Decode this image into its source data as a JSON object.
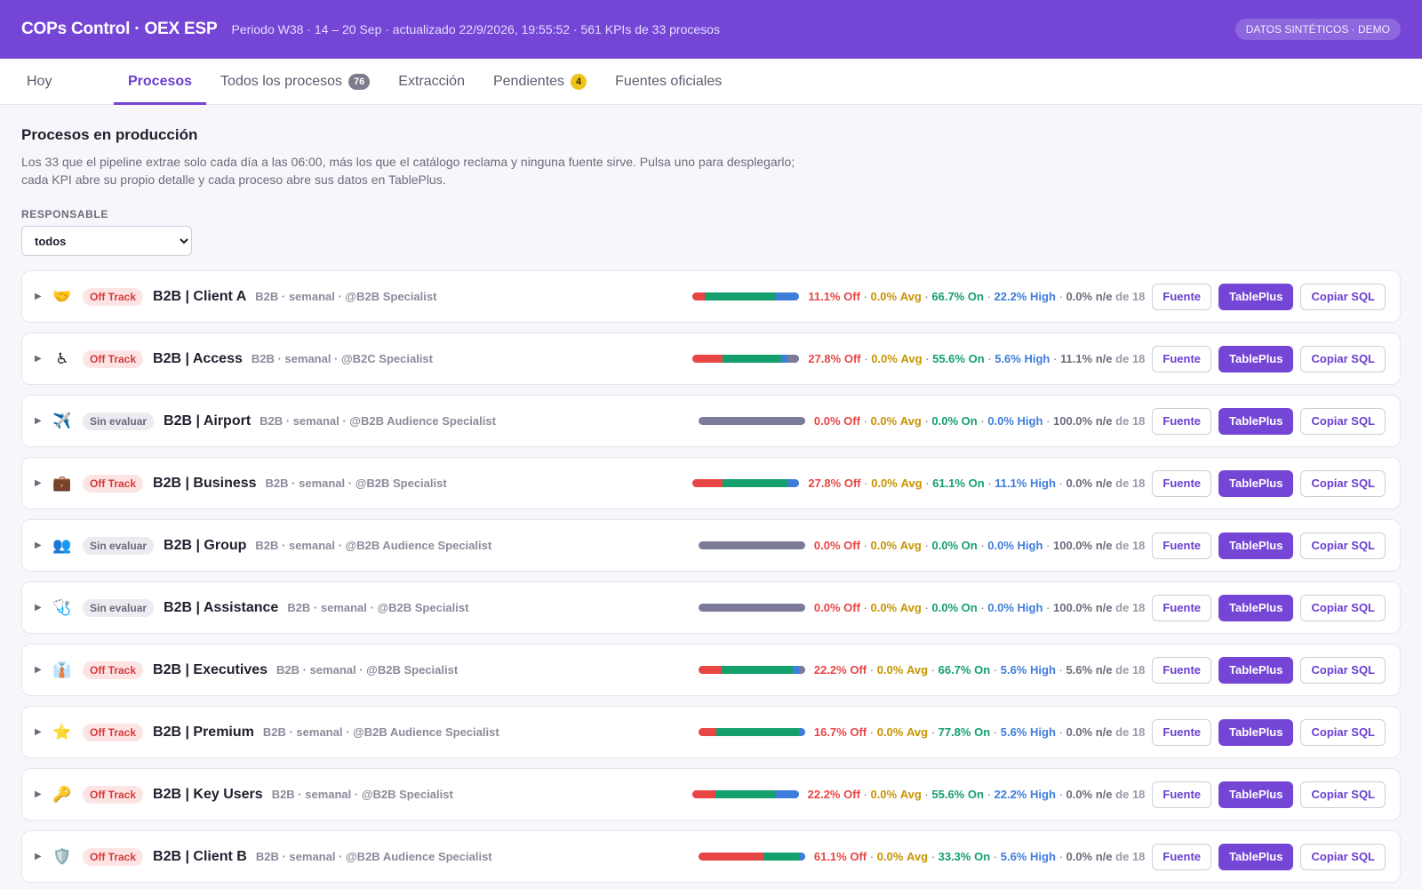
{
  "header": {
    "app_title": "COPs Control · OEX ESP",
    "period": "Periodo W38 · 14 – 20 Sep · actualizado 22/9/2026, 19:55:52 · 561 KPIs de 33 procesos",
    "badge": "DATOS SINTÉTICOS · DEMO"
  },
  "tabs": [
    {
      "label": "Hoy",
      "active": false,
      "count": null
    },
    {
      "label": "Procesos",
      "active": true,
      "count": null
    },
    {
      "label": "Todos los procesos",
      "active": false,
      "count": "76",
      "count_color": "gray"
    },
    {
      "label": "Extracción",
      "active": false,
      "count": null
    },
    {
      "label": "Pendientes",
      "active": false,
      "count": "4",
      "count_color": "yellow"
    },
    {
      "label": "Fuentes oficiales",
      "active": false,
      "count": null
    }
  ],
  "section": {
    "title": "Procesos en producción",
    "description": "Los 33 que el pipeline extrae solo cada día a las 06:00, más los que el catálogo reclama y ninguna fuente sirve. Pulsa uno para desplegarlo; cada KPI abre su propio detalle y cada proceso abre sus datos en TablePlus."
  },
  "filter": {
    "label": "RESPONSABLE",
    "selected": "todos"
  },
  "labels": {
    "off": "Off",
    "avg": "Avg",
    "on": "On",
    "high": "High",
    "ne": "n/e",
    "de": "de",
    "fuente": "Fuente",
    "tableplus": "TablePlus",
    "copiar_sql": "Copiar SQL"
  },
  "colors": {
    "accent": "#7546d6",
    "off": "#e84545",
    "avg": "#d4a317",
    "on": "#14a06c",
    "high": "#3f7ddc",
    "ne": "#7b7b99"
  },
  "processes": [
    {
      "icon": "🤝",
      "icon_name": "handshake-icon",
      "status": "Off Track",
      "status_kind": "off",
      "name": "B2B | Client A",
      "meta": "B2B · semanal · @B2B Specialist",
      "off": 11.1,
      "avg": 0.0,
      "on": 66.7,
      "high": 22.2,
      "ne": 0.0,
      "total": 18
    },
    {
      "icon": "♿",
      "icon_name": "wheelchair-icon",
      "status": "Off Track",
      "status_kind": "off",
      "name": "B2B | Access",
      "meta": "B2B · semanal · @B2C Specialist",
      "off": 27.8,
      "avg": 0.0,
      "on": 55.6,
      "high": 5.6,
      "ne": 11.1,
      "total": 18
    },
    {
      "icon": "✈️",
      "icon_name": "airplane-icon",
      "status": "Sin evaluar",
      "status_kind": "sin",
      "name": "B2B | Airport",
      "meta": "B2B · semanal · @B2B Audience Specialist",
      "off": 0.0,
      "avg": 0.0,
      "on": 0.0,
      "high": 0.0,
      "ne": 100.0,
      "total": 18
    },
    {
      "icon": "💼",
      "icon_name": "briefcase-icon",
      "status": "Off Track",
      "status_kind": "off",
      "name": "B2B | Business",
      "meta": "B2B · semanal · @B2B Specialist",
      "off": 27.8,
      "avg": 0.0,
      "on": 61.1,
      "high": 11.1,
      "ne": 0.0,
      "total": 18
    },
    {
      "icon": "👥",
      "icon_name": "group-icon",
      "status": "Sin evaluar",
      "status_kind": "sin",
      "name": "B2B | Group",
      "meta": "B2B · semanal · @B2B Audience Specialist",
      "off": 0.0,
      "avg": 0.0,
      "on": 0.0,
      "high": 0.0,
      "ne": 100.0,
      "total": 18
    },
    {
      "icon": "🩺",
      "icon_name": "stethoscope-icon",
      "status": "Sin evaluar",
      "status_kind": "sin",
      "name": "B2B | Assistance",
      "meta": "B2B · semanal · @B2B Specialist",
      "off": 0.0,
      "avg": 0.0,
      "on": 0.0,
      "high": 0.0,
      "ne": 100.0,
      "total": 18
    },
    {
      "icon": "👔",
      "icon_name": "necktie-icon",
      "status": "Off Track",
      "status_kind": "off",
      "name": "B2B | Executives",
      "meta": "B2B · semanal · @B2B Specialist",
      "off": 22.2,
      "avg": 0.0,
      "on": 66.7,
      "high": 5.6,
      "ne": 5.6,
      "total": 18
    },
    {
      "icon": "⭐",
      "icon_name": "star-icon",
      "status": "Off Track",
      "status_kind": "off",
      "name": "B2B | Premium",
      "meta": "B2B · semanal · @B2B Audience Specialist",
      "off": 16.7,
      "avg": 0.0,
      "on": 77.8,
      "high": 5.6,
      "ne": 0.0,
      "total": 18
    },
    {
      "icon": "🔑",
      "icon_name": "key-icon",
      "status": "Off Track",
      "status_kind": "off",
      "name": "B2B | Key Users",
      "meta": "B2B · semanal · @B2B Specialist",
      "off": 22.2,
      "avg": 0.0,
      "on": 55.6,
      "high": 22.2,
      "ne": 0.0,
      "total": 18
    },
    {
      "icon": "🛡️",
      "icon_name": "shield-icon",
      "status": "Off Track",
      "status_kind": "off",
      "name": "B2B | Client B",
      "meta": "B2B · semanal · @B2B Audience Specialist",
      "off": 61.1,
      "avg": 0.0,
      "on": 33.3,
      "high": 5.6,
      "ne": 0.0,
      "total": 18
    }
  ]
}
